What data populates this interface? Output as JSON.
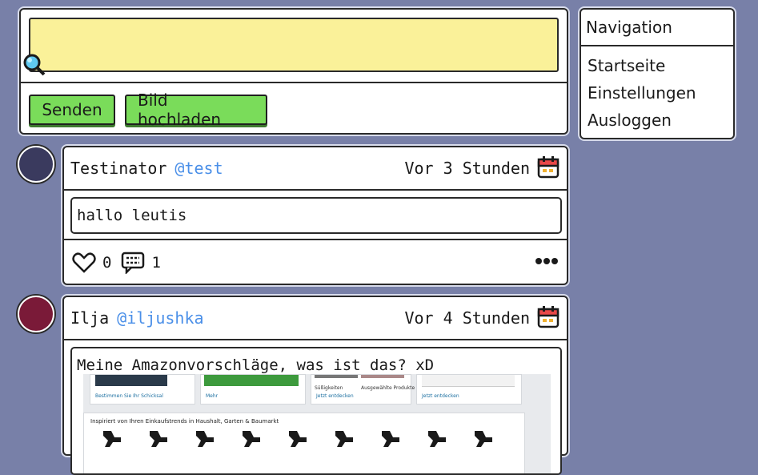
{
  "compose": {
    "input_value": "",
    "send_label": "Senden",
    "upload_label": "Bild hochladen"
  },
  "navigation": {
    "title": "Navigation",
    "items": [
      {
        "label": "Startseite"
      },
      {
        "label": "Einstellungen"
      },
      {
        "label": "Ausloggen"
      }
    ]
  },
  "posts": [
    {
      "author": "Testinator",
      "handle": "@test",
      "time": "Vor 3 Stunden",
      "text": "hallo leutis",
      "likes": "0",
      "comments": "1",
      "avatar_color": "#3a3a5e"
    },
    {
      "author": "Ilja",
      "handle": "@iljushka",
      "time": "Vor 4 Stunden",
      "text": "Meine Amazonvorschläge, was ist das? xD",
      "avatar_color": "#7a1a38",
      "image": {
        "card_labels": [
          "Bestimmen Sie Ihr Schicksal",
          "Mehr",
          "Jetzt entdecken",
          "Jetzt entdecken"
        ],
        "small_labels": [
          "Süßigkeiten",
          "Ausgewählte Produkte"
        ],
        "section_title": "Inspiriert von Ihren Einkaufstrends in Haushalt, Garten & Baumarkt"
      }
    }
  ],
  "colors": {
    "background": "#7880a8",
    "input_yellow": "#faf199",
    "button_green": "#7adc5a",
    "handle_blue": "#4a8fe8"
  },
  "icons": [
    "search-icon",
    "calendar-icon",
    "heart-icon",
    "comment-icon",
    "more-icon"
  ]
}
